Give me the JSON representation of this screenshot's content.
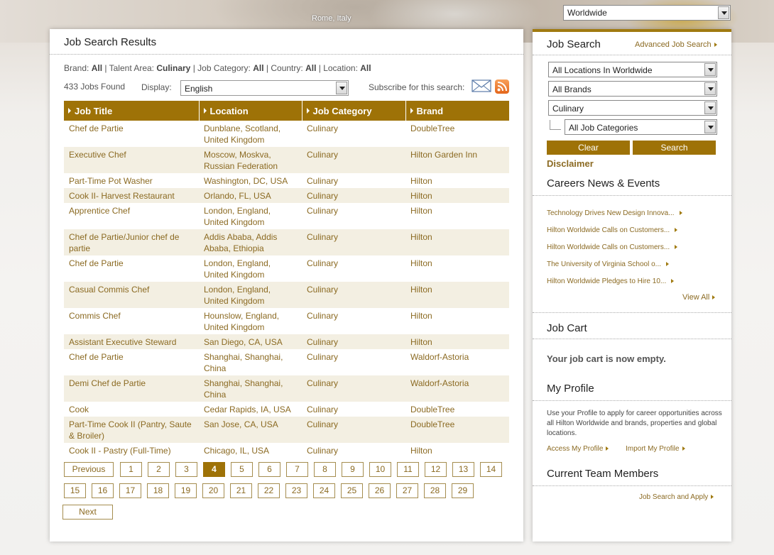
{
  "header": {
    "caption": "Rome, Italy",
    "region_selected": "Worldwide"
  },
  "results": {
    "title": "Job Search Results",
    "filters": {
      "brand_label": "Brand:",
      "brand_value": "All",
      "talent_label": "Talent Area:",
      "talent_value": "Culinary",
      "category_label": "Job Category:",
      "category_value": "All",
      "country_label": "Country:",
      "country_value": "All",
      "location_label": "Location:",
      "location_value": "All"
    },
    "found": "433 Jobs Found",
    "display_label": "Display:",
    "display_value": "English",
    "subscribe_label": "Subscribe for this search:",
    "columns": [
      "Job Title",
      "Location",
      "Job Category",
      "Brand"
    ],
    "rows": [
      {
        "title": "Chef de Partie",
        "location": "Dunblane, Scotland, United Kingdom",
        "category": "Culinary",
        "brand": "DoubleTree"
      },
      {
        "title": "Executive Chef",
        "location": "Moscow, Moskva, Russian Federation",
        "category": "Culinary",
        "brand": "Hilton Garden Inn"
      },
      {
        "title": "Part-Time Pot Washer",
        "location": "Washington, DC, USA",
        "category": "Culinary",
        "brand": "Hilton"
      },
      {
        "title": "Cook II- Harvest Restaurant",
        "location": "Orlando, FL, USA",
        "category": "Culinary",
        "brand": "Hilton"
      },
      {
        "title": "Apprentice Chef",
        "location": "London, England, United Kingdom",
        "category": "Culinary",
        "brand": "Hilton"
      },
      {
        "title": "Chef de Partie/Junior chef de partie",
        "location": "Addis Ababa, Addis Ababa, Ethiopia",
        "category": "Culinary",
        "brand": "Hilton"
      },
      {
        "title": "Chef de Partie",
        "location": "London, England, United Kingdom",
        "category": "Culinary",
        "brand": "Hilton"
      },
      {
        "title": "Casual Commis Chef",
        "location": "London, England, United Kingdom",
        "category": "Culinary",
        "brand": "Hilton"
      },
      {
        "title": "Commis Chef",
        "location": "Hounslow, England, United Kingdom",
        "category": "Culinary",
        "brand": "Hilton"
      },
      {
        "title": "Assistant Executive Steward",
        "location": "San Diego, CA, USA",
        "category": "Culinary",
        "brand": "Hilton"
      },
      {
        "title": "Chef de Partie",
        "location": "Shanghai, Shanghai, China",
        "category": "Culinary",
        "brand": "Waldorf-Astoria"
      },
      {
        "title": "Demi Chef de Partie",
        "location": "Shanghai, Shanghai, China",
        "category": "Culinary",
        "brand": "Waldorf-Astoria"
      },
      {
        "title": "Cook",
        "location": "Cedar Rapids, IA, USA",
        "category": "Culinary",
        "brand": "DoubleTree"
      },
      {
        "title": "Part-Time Cook II (Pantry, Saute & Broiler)",
        "location": "San Jose, CA, USA",
        "category": "Culinary",
        "brand": "DoubleTree"
      },
      {
        "title": "Cook II - Pastry (Full-Time)",
        "location": "Chicago, IL, USA",
        "category": "Culinary",
        "brand": "Hilton"
      }
    ],
    "pager": {
      "previous": "Previous",
      "next": "Next",
      "current": "4",
      "pages": [
        "1",
        "2",
        "3",
        "4",
        "5",
        "6",
        "7",
        "8",
        "9",
        "10",
        "11",
        "12",
        "13",
        "14",
        "15",
        "16",
        "17",
        "18",
        "19",
        "20",
        "21",
        "22",
        "23",
        "24",
        "25",
        "26",
        "27",
        "28",
        "29"
      ]
    }
  },
  "sidebar": {
    "job_search_title": "Job Search",
    "advanced_link": "Advanced Job Search",
    "location_select": "All Locations In Worldwide",
    "brand_select": "All Brands",
    "talent_select": "Culinary",
    "category_select": "All Job Categories",
    "clear_label": "Clear",
    "search_label": "Search",
    "disclaimer": "Disclaimer",
    "news_title": "Careers News & Events",
    "news": [
      "Technology Drives New Design Innova...",
      "Hilton Worldwide Calls on Customers...",
      "Hilton Worldwide Calls on Customers...",
      "The University of Virginia School o...",
      "Hilton Worldwide Pledges to Hire 10..."
    ],
    "view_all": "View All",
    "cart_title": "Job Cart",
    "cart_empty": "Your job cart is now empty.",
    "profile_title": "My Profile",
    "profile_text": "Use your Profile to apply for career opportunities across all Hilton Worldwide and brands, properties and global locations.",
    "access_profile": "Access My Profile",
    "import_profile": "Import My Profile",
    "team_title": "Current Team Members",
    "apply_link": "Job Search and Apply"
  },
  "colors": {
    "accent": "#9e7207",
    "link": "#8b6a22",
    "row_alt": "#f3efe2"
  }
}
